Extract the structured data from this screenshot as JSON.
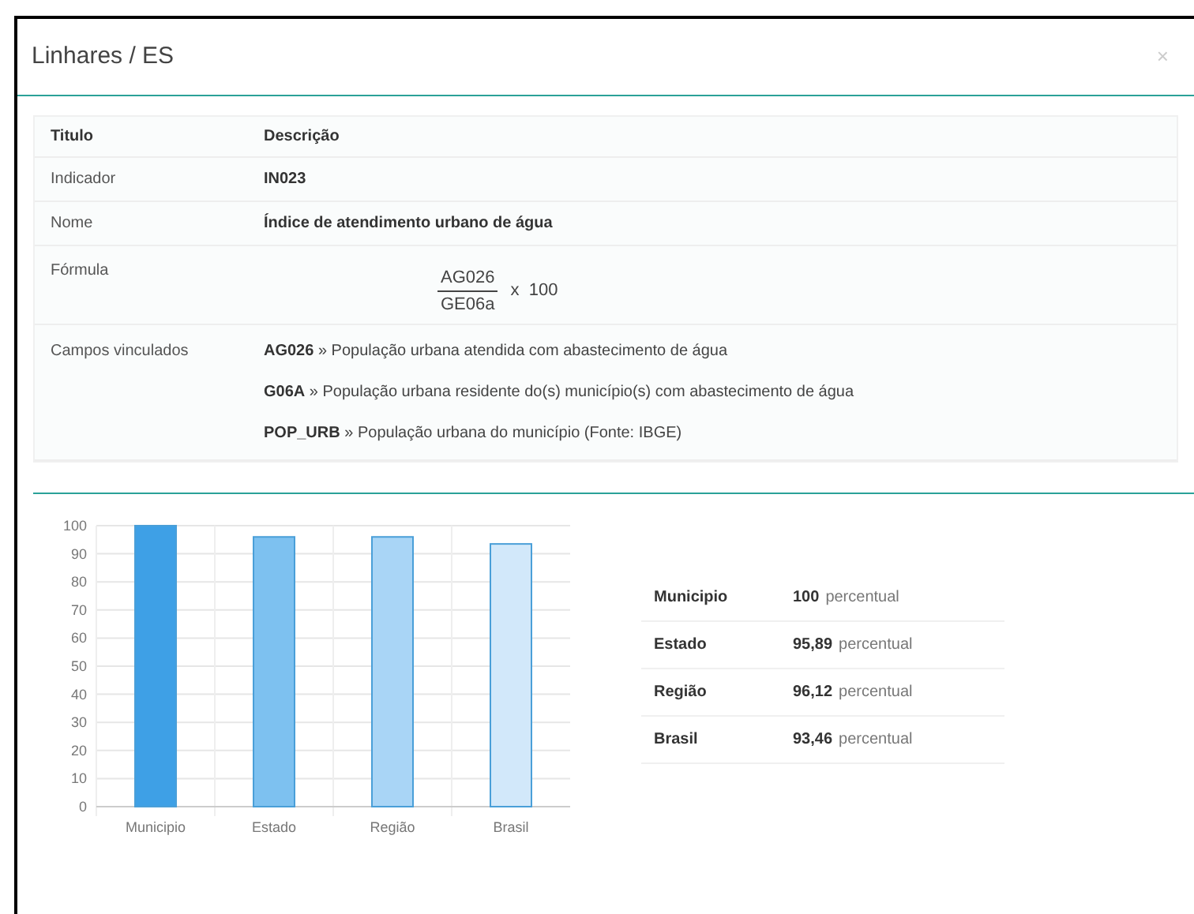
{
  "modal": {
    "title": "Linhares / ES",
    "close": "×"
  },
  "info_table": {
    "columns": [
      "Titulo",
      "Descrição"
    ],
    "rows": [
      {
        "kind": "bold",
        "label": "Indicador",
        "value": "IN023"
      },
      {
        "kind": "bold",
        "label": "Nome",
        "value": "Índice de atendimento urbano de água"
      },
      {
        "kind": "formula",
        "label": "Fórmula",
        "numerator": "AG026",
        "denominator": "GE06a",
        "multiplier": "x  100"
      },
      {
        "kind": "list",
        "label": "Campos vinculados",
        "items": [
          "**AG026** » População urbana atendida com abastecimento de água",
          "**G06A** » População urbana residente do(s) município(s) com abastecimento de água",
          "**POP_URB** » População urbana do município (Fonte: IBGE)"
        ]
      }
    ]
  },
  "chart_data": {
    "type": "bar",
    "categories": [
      "Municipio",
      "Estado",
      "Região",
      "Brasil"
    ],
    "series": [
      {
        "color": "#4a9fd8",
        "values": [
          100,
          96,
          96,
          93.5
        ]
      }
    ],
    "grid": true,
    "colors": [
      "#3ea0e6",
      "#7dc1f0",
      "#a9d5f6",
      "#d2e8fa"
    ],
    "ylim": [
      0,
      100
    ],
    "yticks": [
      0,
      10,
      20,
      30,
      40,
      50,
      60,
      70,
      80,
      90,
      100
    ]
  },
  "summary": [
    {
      "label": "Municipio",
      "value": "100",
      "unit": "percentual"
    },
    {
      "label": "Estado",
      "value": "95,89",
      "unit": "percentual"
    },
    {
      "label": "Região",
      "value": "96,12",
      "unit": "percentual"
    },
    {
      "label": "Brasil",
      "value": "93,46",
      "unit": "percentual"
    }
  ]
}
